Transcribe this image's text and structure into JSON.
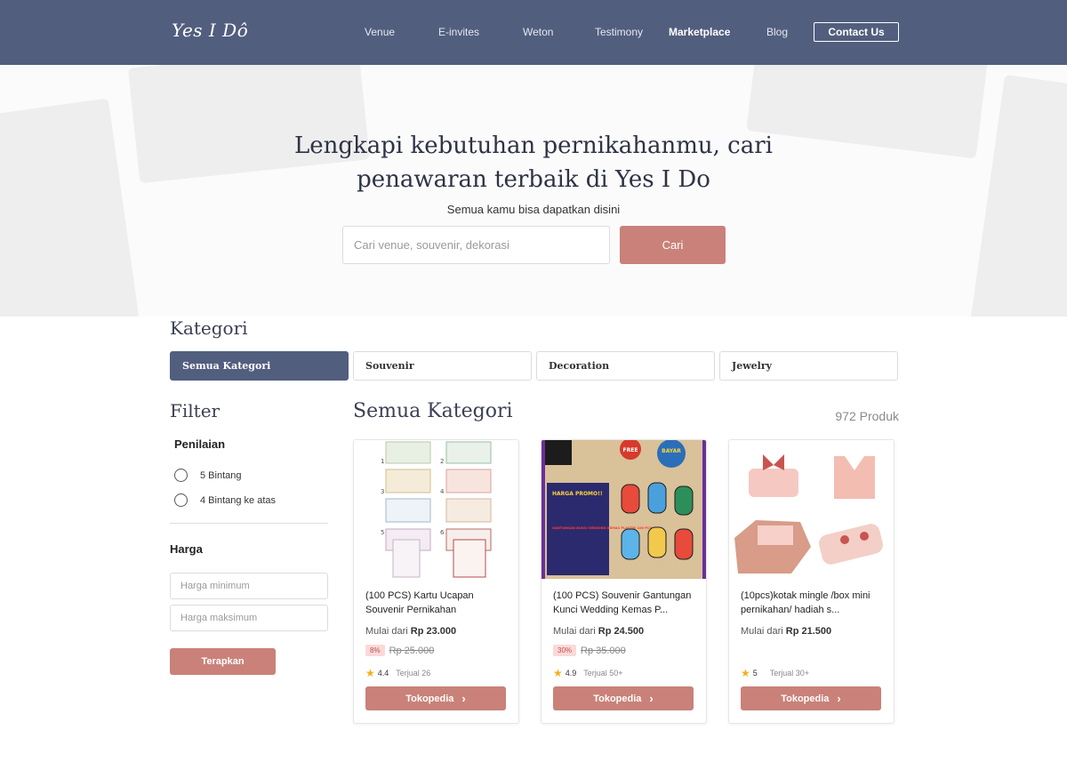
{
  "header": {
    "logo": "Yes I Dô",
    "nav": [
      "Venue",
      "E-invites",
      "Weton",
      "Testimony",
      "Marketplace",
      "Blog"
    ],
    "active_nav": "Marketplace",
    "contact_label": "Contact Us"
  },
  "hero": {
    "title": "Lengkapi kebutuhan pernikahanmu, cari penawaran terbaik di Yes I Do",
    "subtitle": "Semua kamu bisa dapatkan disini",
    "search_placeholder": "Cari venue, souvenir, dekorasi",
    "search_button": "Cari"
  },
  "categories": {
    "title": "Kategori",
    "tabs": [
      "Semua Kategori",
      "Souvenir",
      "Decoration",
      "Jewelry"
    ],
    "active": "Semua Kategori"
  },
  "filter": {
    "title": "Filter",
    "rating_title": "Penilaian",
    "rating_options": [
      "5 Bintang",
      "4 Bintang ke atas"
    ],
    "price_title": "Harga",
    "price_min_placeholder": "Harga minimum",
    "price_max_placeholder": "Harga maksimum",
    "apply_label": "Terapkan"
  },
  "listing": {
    "title": "Semua Kategori",
    "count": "972 Produk"
  },
  "products": [
    {
      "name": "(100 PCS) Kartu Ucapan Souvenir Pernikahan",
      "price_prefix": "Mulai dari",
      "price": "Rp 23.000",
      "discount": "8%",
      "old_price": "Rp 25.000",
      "rating": "4.4",
      "sold": "Terjual 26",
      "button": "Tokopedia"
    },
    {
      "name": "(100 PCS) Souvenir Gantungan Kunci Wedding Kemas P...",
      "price_prefix": "Mulai dari",
      "price": "Rp 24.500",
      "discount": "30%",
      "old_price": "Rp 35.000",
      "rating": "4.9",
      "sold": "Terjual 50+",
      "button": "Tokopedia",
      "image_text": {
        "badge1": "FREE",
        "badge2": "BAYAR",
        "promo": "HARGA PROMO!!",
        "desc": "GANTUNGAN KUNCI WEDDING KEMAS PLASTIK 100 PCS"
      }
    },
    {
      "name": "(10pcs)kotak mingle /box mini pernikahan/ hadiah s...",
      "price_prefix": "Mulai dari",
      "price": "Rp 21.500",
      "rating": "5",
      "sold": "Terjual 30+",
      "button": "Tokopedia"
    }
  ],
  "colors": {
    "header_bg": "#525e7e",
    "accent": "#c98179",
    "star": "#f2b01e"
  }
}
